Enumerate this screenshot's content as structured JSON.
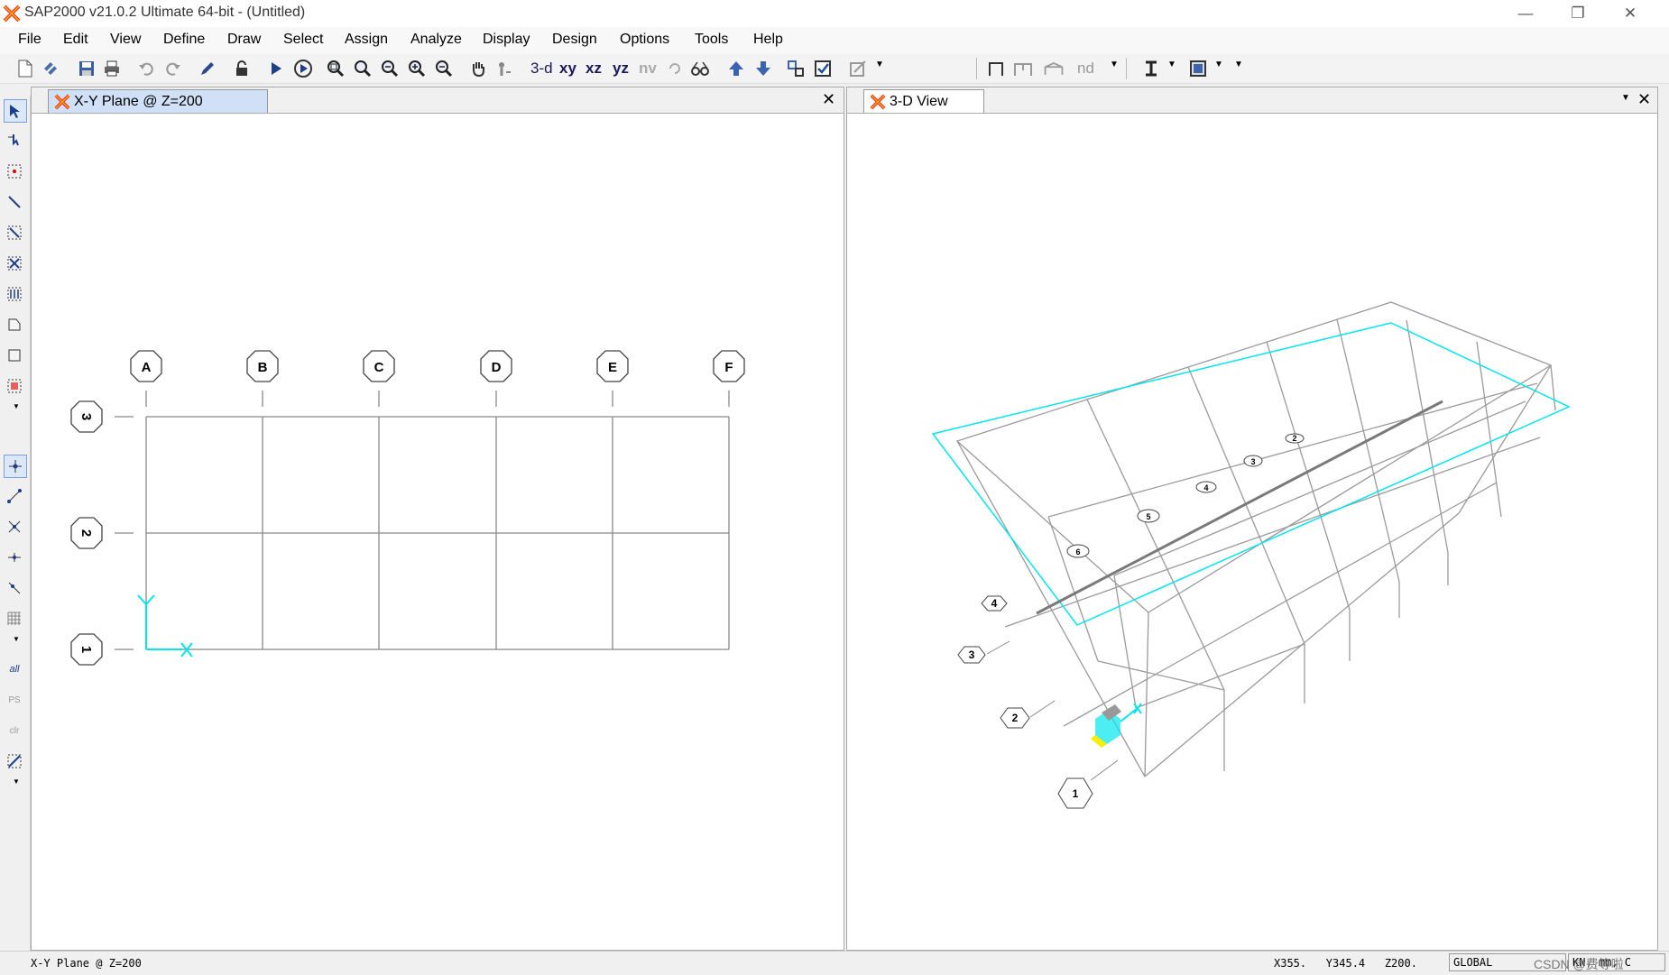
{
  "window": {
    "title": "SAP2000 v21.0.2 Ultimate 64-bit - (Untitled)"
  },
  "menu": [
    "File",
    "Edit",
    "View",
    "Define",
    "Draw",
    "Select",
    "Assign",
    "Analyze",
    "Display",
    "Design",
    "Options",
    "Tools",
    "Help"
  ],
  "toolbar": {
    "view_3d": "3-d",
    "view_xy": "xy",
    "view_xz": "xz",
    "view_yz": "yz",
    "view_nv": "nv",
    "nd": "nd"
  },
  "left_tools": {
    "all": "all",
    "ps": "PS",
    "clr": "clr"
  },
  "panes": {
    "left": {
      "tab_title": "X-Y Plane @ Z=200"
    },
    "right": {
      "tab_title": "3-D View"
    }
  },
  "grid": {
    "columns": [
      "A",
      "B",
      "C",
      "D",
      "E",
      "F"
    ],
    "rows": [
      "3",
      "2",
      "1"
    ],
    "axes": {
      "x": "X",
      "y": "Y"
    }
  },
  "view3d": {
    "bubbles_main": [
      "1",
      "2",
      "3",
      "4"
    ],
    "bubbles_back": [
      "6",
      "5",
      "4",
      "3",
      "2"
    ]
  },
  "status": {
    "plane": "X-Y Plane @ Z=200",
    "coords": "X355.   Y345.4   Z200.",
    "coord_system": "GLOBAL",
    "units": "KN, mm, C",
    "watermark": "CSDN @费等啦"
  },
  "colors": {
    "accent": "#00e5ee",
    "grid_line": "#888888",
    "tab_active": "#cfe0f7"
  }
}
